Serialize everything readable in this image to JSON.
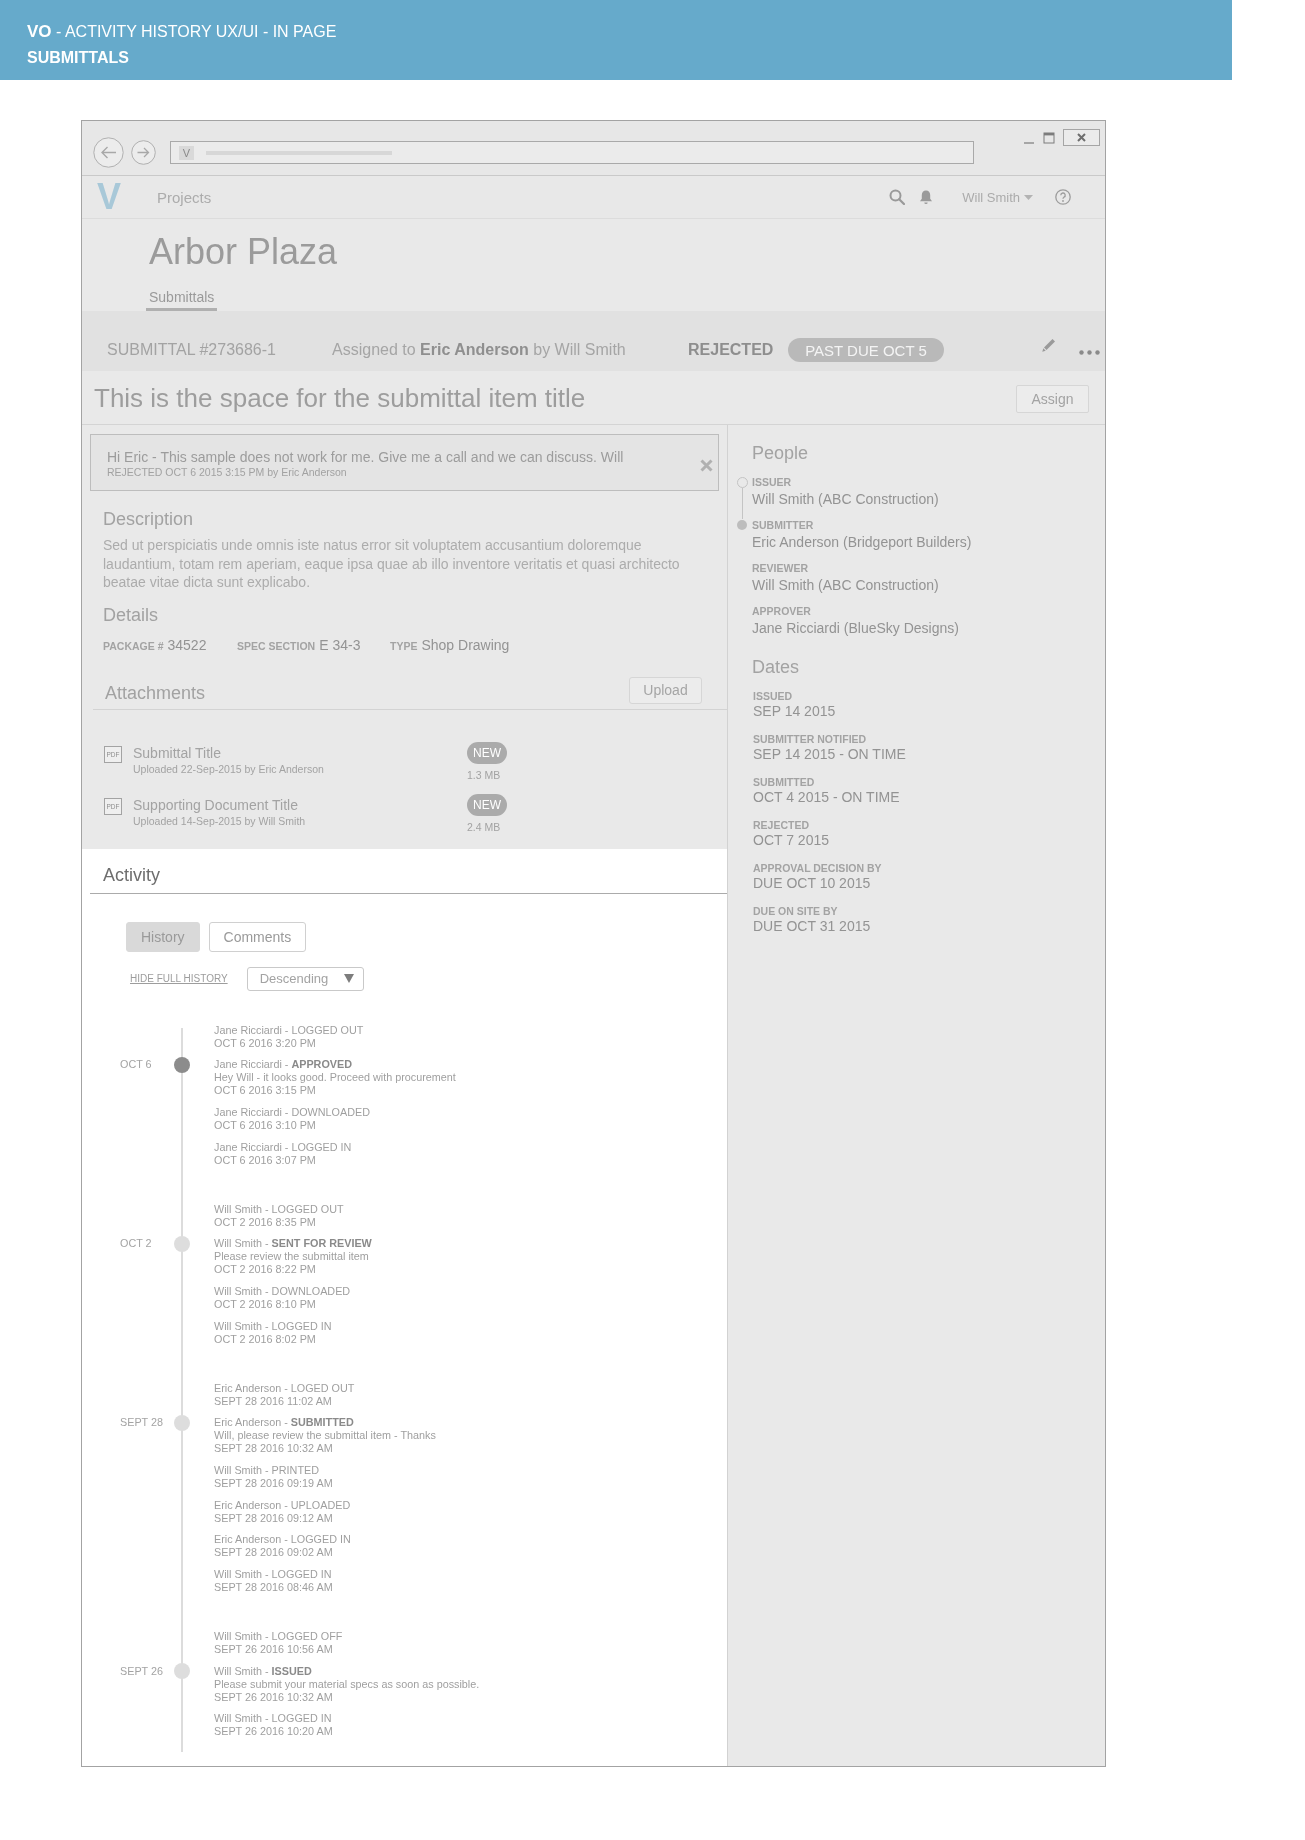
{
  "banner": {
    "title": "**VO** - ACTIVITY HISTORY UX/UI - IN PAGE",
    "subtitle": "SUBMITTALS"
  },
  "browser": {
    "favicon": "V"
  },
  "nav": {
    "logo": "V",
    "link": "Projects",
    "user": "Will Smith"
  },
  "project": {
    "name": "Arbor Plaza",
    "tabs": [
      {
        "label": "Submittals",
        "selected": true
      }
    ]
  },
  "submittal": {
    "number": "SUBMITTAL #273686-1",
    "assignment": "Assigned to **Eric Anderson** by Will Smith",
    "status": "REJECTED",
    "due": "PAST DUE OCT 5",
    "title": "This is the space for the submittal item title",
    "assign_button": "Assign"
  },
  "message": {
    "text": "Hi Eric - This sample does not work for me. Give me a call and we can discuss. Will",
    "meta": "REJECTED OCT 6 2015 3:15 PM by Eric Anderson"
  },
  "description": {
    "heading": "Description",
    "text": "Sed ut perspiciatis unde omnis iste natus error sit voluptatem accusantium doloremque laudantium, totam rem aperiam, eaque ipsa quae ab illo inventore veritatis et quasi architecto beatae vitae dicta sunt explicabo."
  },
  "details": {
    "heading": "Details",
    "fields": [
      {
        "label": "PACKAGE #",
        "value": "34522"
      },
      {
        "label": "SPEC SECTION",
        "value": "E 34-3"
      },
      {
        "label": "TYPE",
        "value": "Shop Drawing"
      }
    ]
  },
  "attachments": {
    "heading": "Attachments",
    "upload_button": "Upload",
    "files": [
      {
        "file_type": "PDF",
        "title": "Submittal Title",
        "meta": "Uploaded 22-Sep-2015 by Eric Anderson",
        "badge": "NEW",
        "size": "1.3 MB"
      },
      {
        "file_type": "PDF",
        "title": "Supporting Document Title",
        "meta": "Uploaded 14-Sep-2015 by Will Smith",
        "badge": "NEW",
        "size": "2.4 MB"
      }
    ]
  },
  "activity": {
    "heading": "Activity",
    "tabs": [
      {
        "label": "History",
        "selected": true
      },
      {
        "label": "Comments",
        "selected": false
      }
    ],
    "toggle_link": "HIDE FULL HISTORY",
    "sort": {
      "value": "Descending"
    },
    "timeline": [
      {
        "date": "OCT 6",
        "color": "#8c8c8c",
        "entries": [
          {
            "kind": "event",
            "line": "Jane Ricciardi - LOGGED OUT",
            "time": "OCT 6 2016 3:20 PM"
          },
          {
            "kind": "milestone",
            "line": "Jane Ricciardi - **APPROVED**",
            "message": "Hey Will - it looks good. Proceed with procurement",
            "time": "OCT 6 2016 3:15 PM"
          },
          {
            "kind": "event",
            "line": "Jane Ricciardi - DOWNLOADED",
            "time": "OCT 6 2016 3:10 PM"
          },
          {
            "kind": "event",
            "line": "Jane Ricciardi - LOGGED IN",
            "time": "OCT 6 2016 3:07 PM"
          }
        ]
      },
      {
        "date": "OCT 2",
        "color": "#dddddd",
        "entries": [
          {
            "kind": "event",
            "line": "Will Smith - LOGGED OUT",
            "time": "OCT 2 2016 8:35 PM"
          },
          {
            "kind": "milestone",
            "line": "Will Smith - **SENT FOR REVIEW**",
            "message": "Please review the submittal item",
            "time": "OCT 2 2016 8:22 PM"
          },
          {
            "kind": "event",
            "line": "Will Smith - DOWNLOADED",
            "time": "OCT 2 2016 8:10 PM"
          },
          {
            "kind": "event",
            "line": "Will Smith - LOGGED IN",
            "time": "OCT 2 2016 8:02 PM"
          }
        ]
      },
      {
        "date": "SEPT 28",
        "color": "#dddddd",
        "entries": [
          {
            "kind": "event",
            "line": "Eric Anderson - LOGED OUT",
            "time": "SEPT 28 2016 11:02 AM"
          },
          {
            "kind": "milestone",
            "line": "Eric Anderson - **SUBMITTED**",
            "message": "Will, please review the submittal item - Thanks",
            "time": "SEPT 28 2016 10:32 AM"
          },
          {
            "kind": "event",
            "line": "Will Smith - PRINTED",
            "time": "SEPT 28 2016 09:19 AM"
          },
          {
            "kind": "event",
            "line": "Eric Anderson - UPLOADED",
            "time": "SEPT 28 2016 09:12 AM"
          },
          {
            "kind": "event",
            "line": "Eric Anderson - LOGGED IN",
            "time": "SEPT 28 2016 09:02 AM"
          },
          {
            "kind": "event",
            "line": "Will Smith - LOGGED IN",
            "time": "SEPT 28 2016 08:46 AM"
          }
        ]
      },
      {
        "date": "SEPT 26",
        "color": "#dddddd",
        "entries": [
          {
            "kind": "event",
            "line": "Will Smith - LOGGED OFF",
            "time": "SEPT 26 2016 10:56 AM"
          },
          {
            "kind": "milestone",
            "line": "Will Smith - **ISSUED**",
            "message": "Please submit your material specs as soon as possible.",
            "time": "SEPT 26 2016 10:32 AM"
          },
          {
            "kind": "event",
            "line": "Will Smith - LOGGED IN",
            "time": "SEPT 26 2016 10:20 AM"
          }
        ]
      }
    ]
  },
  "people": {
    "heading": "People",
    "items": [
      {
        "role": "ISSUER",
        "name": "Will Smith (ABC Construction)",
        "kind": "done"
      },
      {
        "role": "SUBMITTER",
        "name": "Eric Anderson (Bridgeport Builders)",
        "kind": "current"
      },
      {
        "role": "REVIEWER",
        "name": "Will Smith (ABC Construction)",
        "kind": "pending"
      },
      {
        "role": "APPROVER",
        "name": "Jane Ricciardi (BlueSky Designs)",
        "kind": "pending"
      }
    ]
  },
  "dates": {
    "heading": "Dates",
    "items": [
      {
        "label": "ISSUED",
        "value": "SEP 14 2015"
      },
      {
        "label": "SUBMITTER NOTIFIED",
        "value": "SEP 14 2015 - ON TIME"
      },
      {
        "label": "SUBMITTED",
        "value": "OCT 4 2015 - ON TIME"
      },
      {
        "label": "REJECTED",
        "value": "OCT 7 2015"
      },
      {
        "label": "APPROVAL DECISION BY",
        "value": "DUE OCT 10 2015"
      },
      {
        "label": "DUE ON SITE BY",
        "value": "DUE OCT 31 2015"
      }
    ]
  }
}
